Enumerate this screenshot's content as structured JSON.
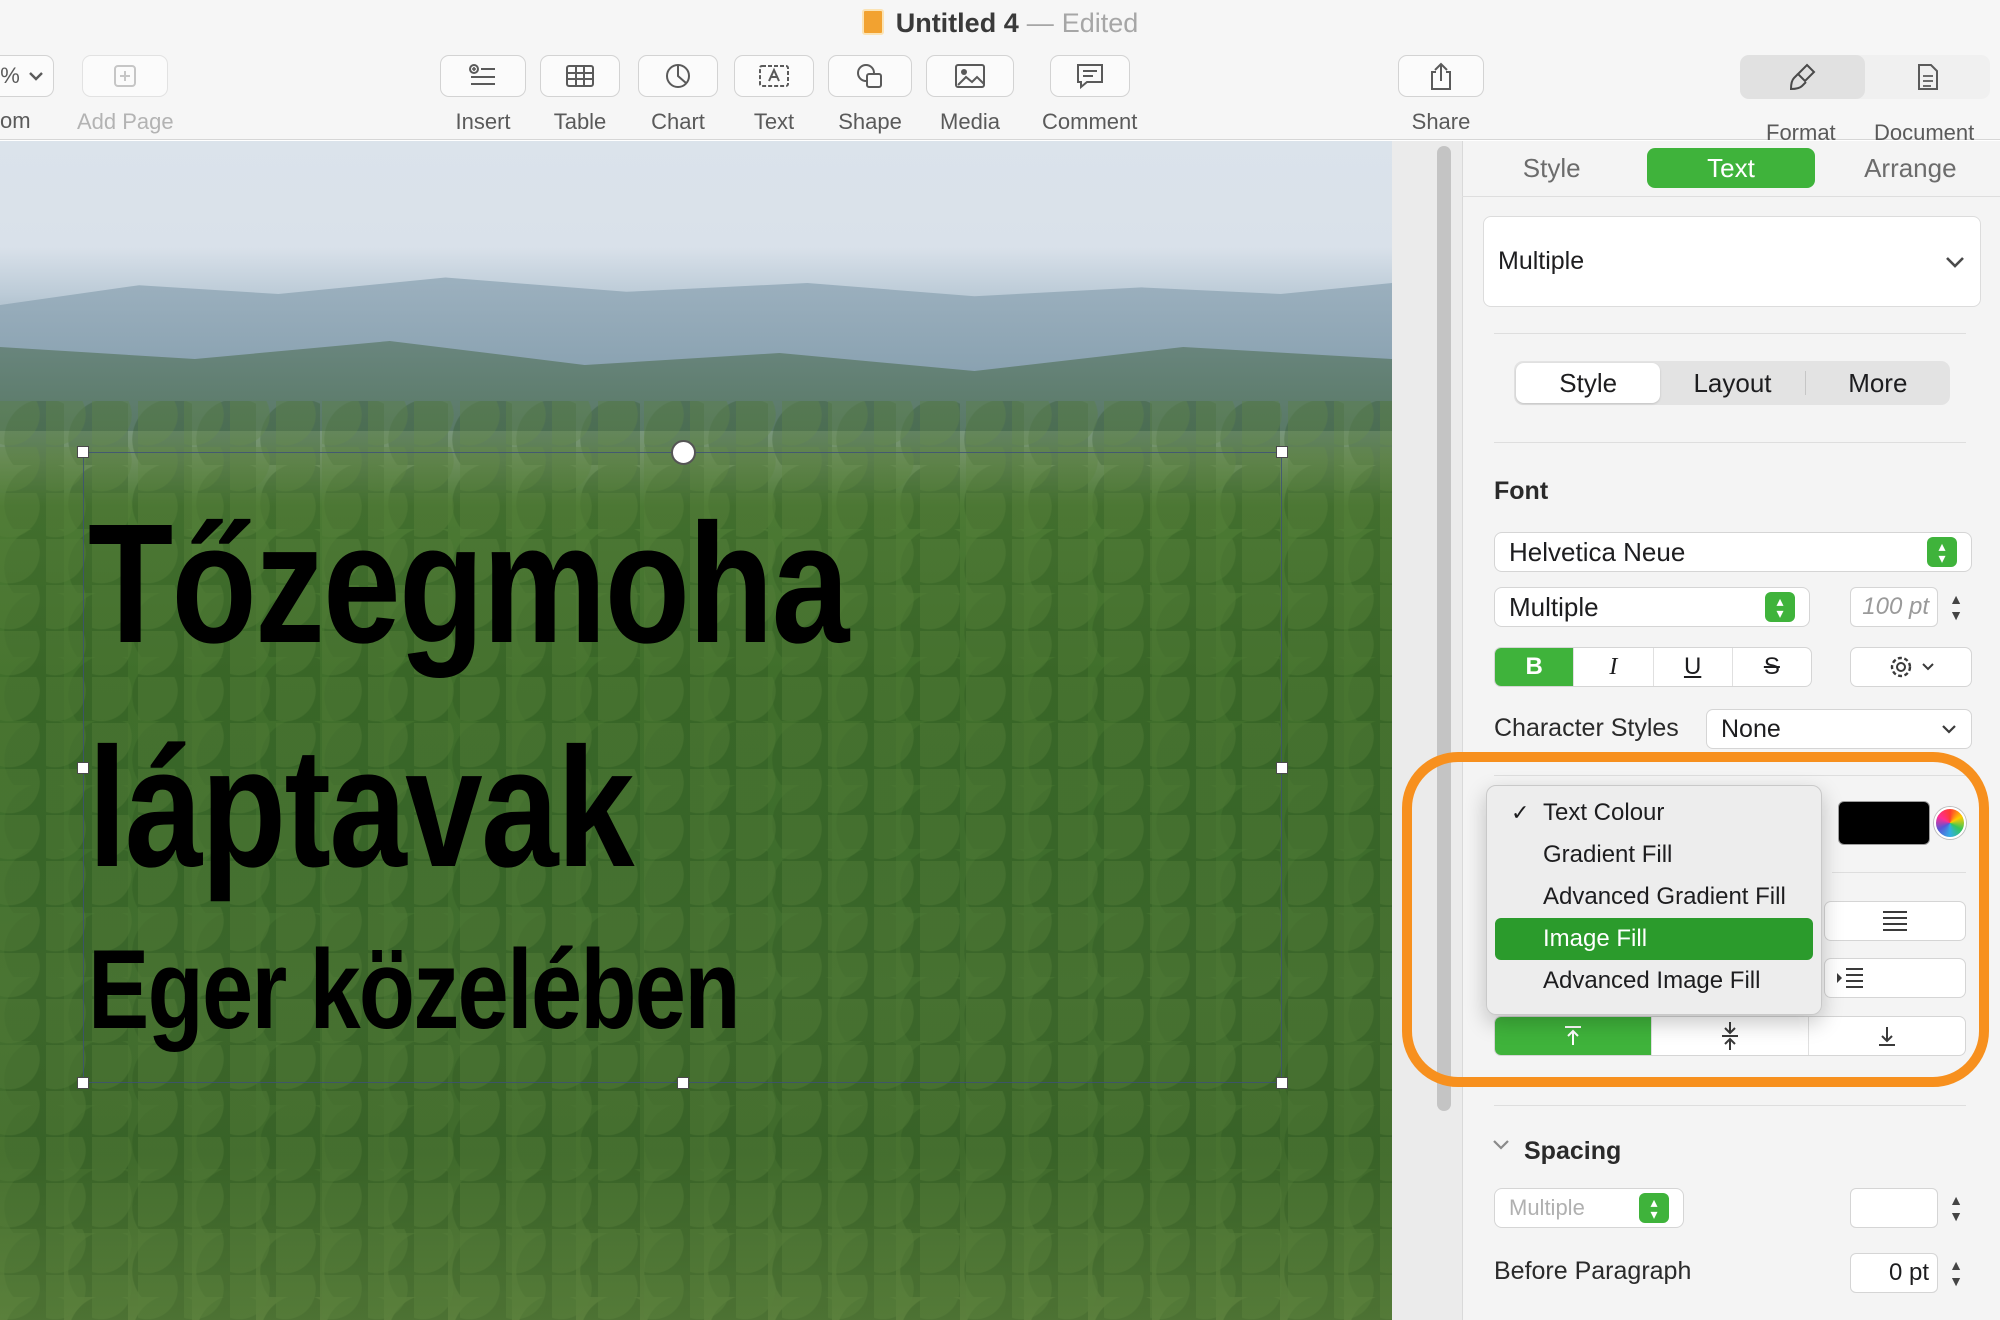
{
  "window": {
    "title": "Untitled 4",
    "status": "Edited",
    "zoom_value": "%",
    "zoom_label": "om"
  },
  "toolbar": {
    "items": [
      {
        "label": "Add Page",
        "icon": "plus-square-icon"
      },
      {
        "label": "Insert",
        "icon": "insert-list-icon"
      },
      {
        "label": "Table",
        "icon": "table-icon"
      },
      {
        "label": "Chart",
        "icon": "chart-pie-icon"
      },
      {
        "label": "Text",
        "icon": "text-box-icon"
      },
      {
        "label": "Shape",
        "icon": "shape-icon"
      },
      {
        "label": "Media",
        "icon": "photo-icon"
      },
      {
        "label": "Comment",
        "icon": "comment-icon"
      },
      {
        "label": "Share",
        "icon": "share-icon"
      },
      {
        "label": "Format",
        "icon": "paintbrush-icon"
      },
      {
        "label": "Document",
        "icon": "document-icon"
      }
    ]
  },
  "canvas": {
    "line1": "Tőzegmoha",
    "line2": "láptavak",
    "line3": "Eger közelében"
  },
  "inspector": {
    "tabs": [
      "Style",
      "Text",
      "Arrange"
    ],
    "active_tab": "Text",
    "paragraph_style": "Multiple",
    "subtabs": [
      "Style",
      "Layout",
      "More"
    ],
    "font_heading": "Font",
    "font_family": "Helvetica Neue",
    "font_typeface": "Multiple",
    "font_size": "100 pt",
    "format_buttons": [
      "B",
      "I",
      "U",
      "S"
    ],
    "character_styles_label": "Character Styles",
    "character_styles_value": "None",
    "spacing_heading": "Spacing",
    "spacing_value": "Multiple",
    "before_paragraph_label": "Before Paragraph",
    "before_paragraph_value": "0 pt"
  },
  "fill_menu": {
    "items": [
      "Text Colour",
      "Gradient Fill",
      "Advanced Gradient Fill",
      "Image Fill",
      "Advanced Image Fill"
    ],
    "checked": "Text Colour",
    "highlighted": "Image Fill"
  },
  "colors": {
    "accent_green": "#3fb33b",
    "highlight_orange": "#f7901e",
    "text_colour_well": "#000000"
  }
}
